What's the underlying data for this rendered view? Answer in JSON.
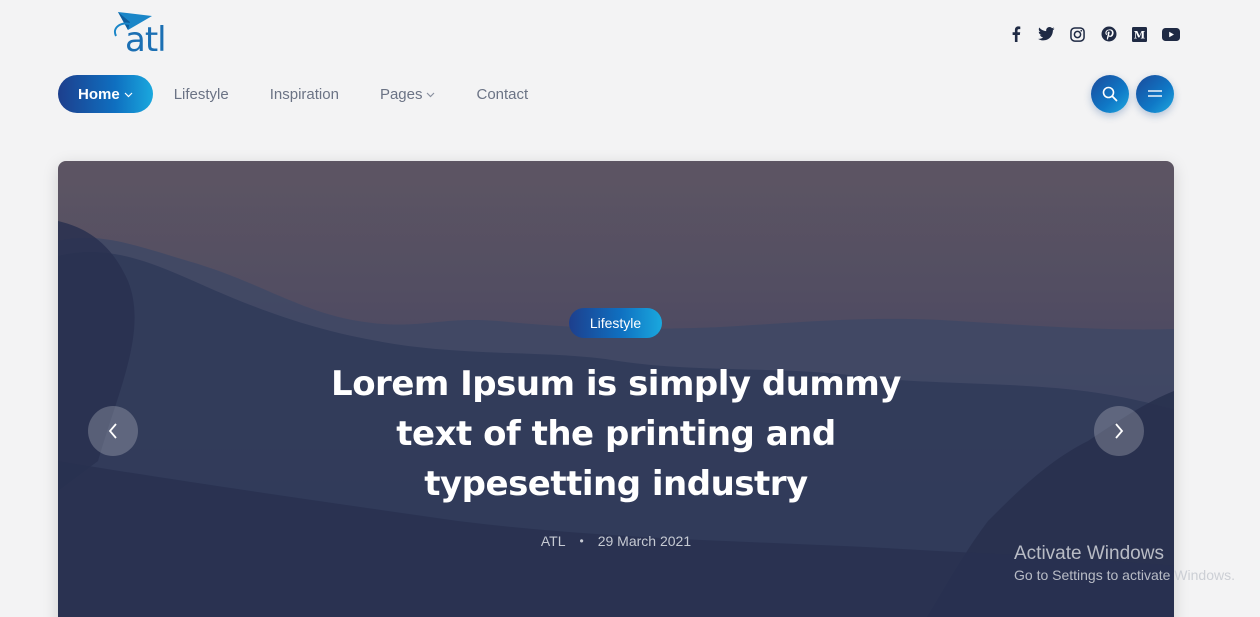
{
  "brand": {
    "logo_text": "atl",
    "accent_dark": "#1d3f8d",
    "accent_light": "#1aa8de"
  },
  "social": [
    {
      "icon": "facebook-icon"
    },
    {
      "icon": "twitter-icon"
    },
    {
      "icon": "instagram-icon"
    },
    {
      "icon": "pinterest-icon"
    },
    {
      "icon": "medium-icon"
    },
    {
      "icon": "youtube-icon"
    }
  ],
  "nav": {
    "home": "Home",
    "lifestyle": "Lifestyle",
    "inspiration": "Inspiration",
    "pages": "Pages",
    "contact": "Contact"
  },
  "hero": {
    "category": "Lifestyle",
    "title": "Lorem Ipsum is simply dummy text of the printing and typesetting industry",
    "author": "ATL",
    "date": "29 March 2021"
  },
  "watermark": {
    "title": "Activate Windows",
    "subtitle": "Go to Settings to activate Windows."
  }
}
